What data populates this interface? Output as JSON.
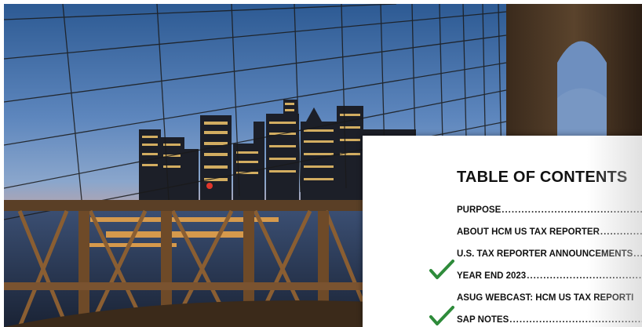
{
  "photo": {
    "subject": "brooklyn-bridge-cables-city-skyline-dusk"
  },
  "toc": {
    "title": "TABLE OF CONTENTS",
    "check_color": "#2e8b3a",
    "items": [
      {
        "label": "PURPOSE",
        "dots": "............................................................................................",
        "checked": false
      },
      {
        "label": "ABOUT HCM US TAX REPORTER",
        "dots": "............................................................",
        "checked": false
      },
      {
        "label": "U.S. TAX REPORTER ANNOUNCEMENTS",
        "dots": "......................................",
        "checked": false
      },
      {
        "label": "YEAR END 2023",
        "dots": "............................................................................................",
        "checked": true
      },
      {
        "label": "ASUG WEBCAST: HCM US TAX REPORTI",
        "dots": "",
        "checked": false
      },
      {
        "label": "SAP NOTES",
        "dots": "............................................................................................",
        "checked": true
      }
    ]
  }
}
